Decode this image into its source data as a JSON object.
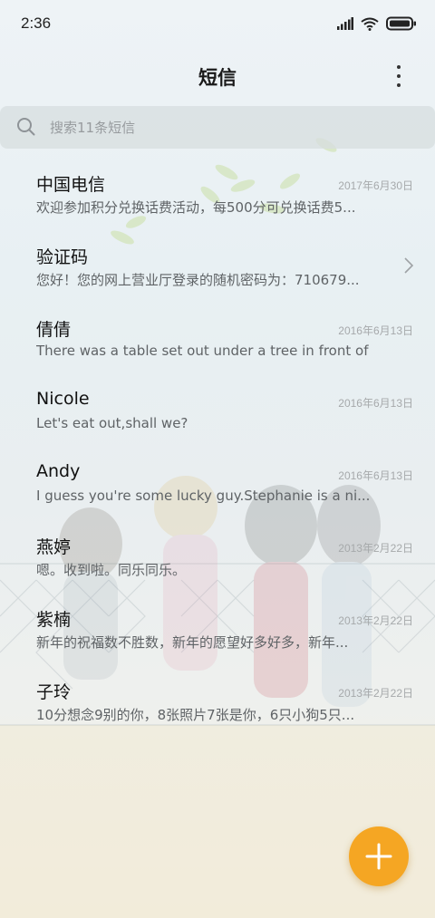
{
  "status_bar": {
    "time": "2:36"
  },
  "header": {
    "title": "短信"
  },
  "search": {
    "placeholder": "搜索11条短信"
  },
  "messages": [
    {
      "name": "中国电信",
      "date": "2017年6月30日",
      "preview": "欢迎参加积分兑换话费活动，每500分可兑换话费5..."
    },
    {
      "name": "验证码",
      "date": "",
      "preview": "您好！您的网上营业厅登录的随机密码为：710679..."
    },
    {
      "name": "倩倩",
      "date": "2016年6月13日",
      "preview": "There was a table set out under a tree in front of ..."
    },
    {
      "name": "Nicole",
      "date": "2016年6月13日",
      "preview": "Let's eat out,shall we?"
    },
    {
      "name": "Andy",
      "date": "2016年6月13日",
      "preview": "I guess you're some lucky guy.Stephanie is a ni..."
    },
    {
      "name": "燕婷",
      "date": "2013年2月22日",
      "preview": "嗯。收到啦。同乐同乐。"
    },
    {
      "name": "紫楠",
      "date": "2013年2月22日",
      "preview": "新年的祝福数不胜数，新年的愿望好多好多，新年..."
    },
    {
      "name": "子玲",
      "date": "2013年2月22日",
      "preview": "10分想念9别的你，8张照片7张是你，6只小狗5只..."
    }
  ],
  "colors": {
    "accent": "#f5a623",
    "title": "#1a1a1a",
    "preview": "#5f6366",
    "date": "#a6a9ab"
  },
  "icons": {
    "search": "search-icon",
    "more": "more-vertical-icon",
    "chevron": "chevron-right-icon",
    "fab": "plus-icon"
  }
}
